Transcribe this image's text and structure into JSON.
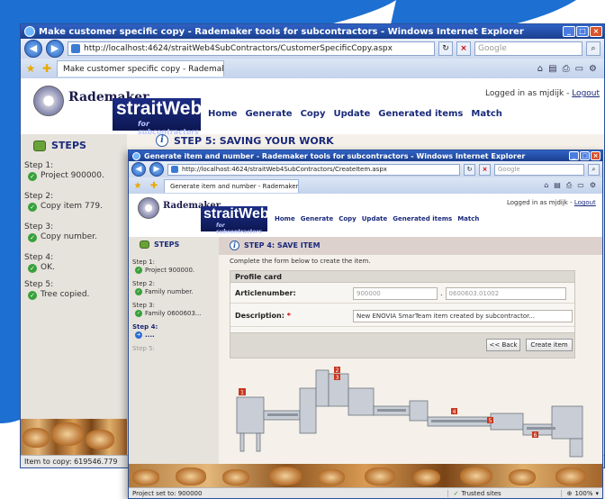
{
  "colors": {
    "accent_blue": "#1d6fd1",
    "title_bar": "#1f4ba8",
    "brand_navy": "#14247a",
    "page_bg": "#f5f1ea"
  },
  "back": {
    "title": "Make customer specific copy - Rademaker tools for subcontractors - Windows Internet Explorer",
    "url": "http://localhost:4624/straitWeb4SubContractors/CustomerSpecificCopy.aspx",
    "search_placeholder": "Google",
    "tab_label": "Make customer specific copy - Rademaker tools for su...",
    "logo_text": "Rademaker",
    "brand": "straitWeb",
    "brand_sub": "for subcontractors",
    "nav": [
      "Home",
      "Generate",
      "Copy",
      "Update",
      "Generated items",
      "Match"
    ],
    "logged_in": "Logged in as mjdijk - ",
    "logout": "Logout",
    "steps_title": "STEPS",
    "step_heading": "STEP 5: SAVING YOUR WORK",
    "steps": [
      {
        "label": "Step 1:",
        "text": "Project 900000."
      },
      {
        "label": "Step 2:",
        "text": "Copy item 779."
      },
      {
        "label": "Step 3:",
        "text": "Copy number."
      },
      {
        "label": "Step 4:",
        "text": "OK."
      },
      {
        "label": "Step 5:",
        "text": "Tree copied."
      }
    ],
    "status": "Item to copy: 619546.779"
  },
  "front": {
    "title": "Generate item and number - Rademaker tools for subcontractors - Windows Internet Explorer",
    "url": "http://localhost:4624/straitWeb4SubContractors/CreateItem.aspx",
    "search_placeholder": "Google",
    "tab_label": "Generate item and number - Rademaker tools for sub...",
    "logo_text": "Rademaker",
    "brand": "straitWeb",
    "brand_sub": "for subcontractors",
    "nav": [
      "Home",
      "Generate",
      "Copy",
      "Update",
      "Generated items",
      "Match"
    ],
    "logged_in": "Logged in as mjdijk - ",
    "logout": "Logout",
    "steps_title": "STEPS",
    "step_heading": "STEP 4: SAVE ITEM",
    "steps": [
      {
        "label": "Step 1:",
        "text": "Project 900000."
      },
      {
        "label": "Step 2:",
        "text": "Family number."
      },
      {
        "label": "Step 3:",
        "text": "Family 0600603..."
      },
      {
        "label": "Step 4:",
        "text": "...."
      },
      {
        "label": "Step 5:",
        "text": ""
      }
    ],
    "form_lead": "Complete the form below to create the item.",
    "profile_title": "Profile card",
    "article_label": "Articlenumber:",
    "article_prefix": "900000",
    "article_sep": ".",
    "article_number": "0600603.01002",
    "desc_label": "Description:",
    "required_mark": "*",
    "desc_value": "New ENOVIA SmarTeam item created by subcontractor...",
    "back_button": "<< Back",
    "create_button": "Create item",
    "machine_labels": [
      "1",
      "2",
      "3",
      "4",
      "5",
      "6"
    ],
    "status": "Project set to: 900000",
    "status_zone": "Trusted sites",
    "zoom": "100%"
  }
}
